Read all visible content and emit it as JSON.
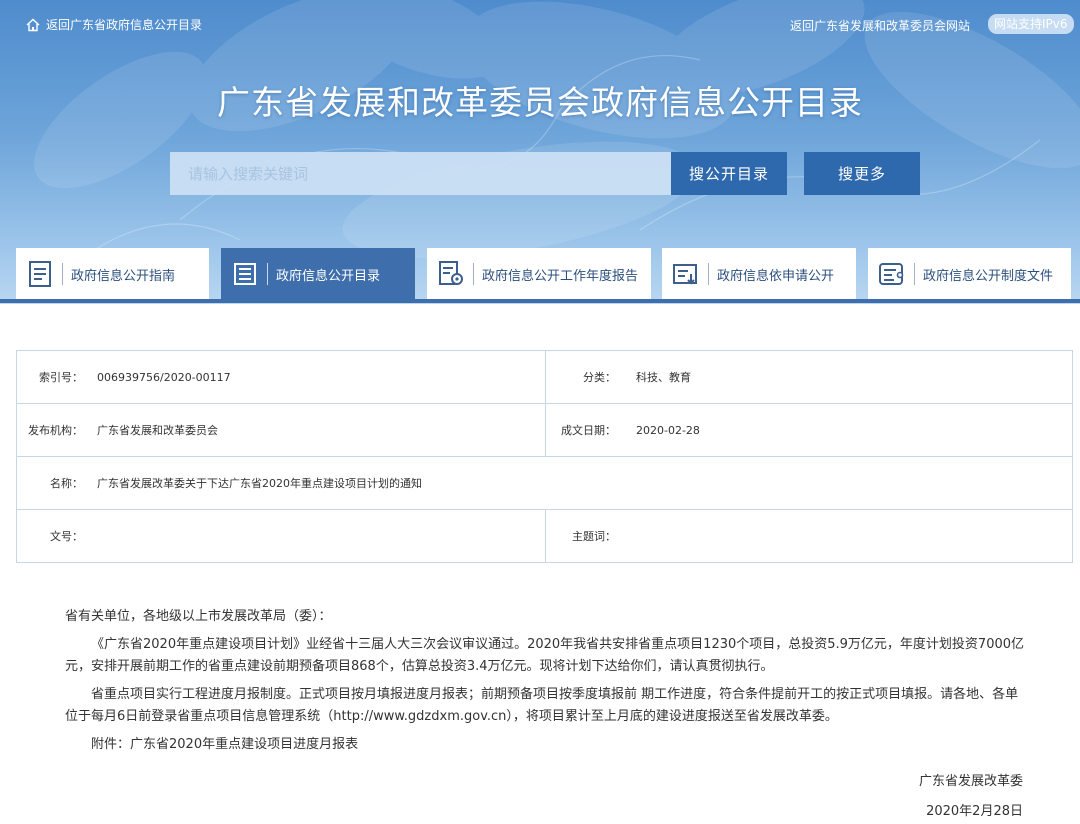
{
  "topbar": {
    "home_link": "返回广东省政府信息公开目录",
    "site_link": "返回广东省发展和改革委员会网站",
    "ipv6_badge": "网站支持IPv6"
  },
  "hero": {
    "title": "广东省发展和改革委员会政府信息公开目录",
    "search_placeholder": "请输入搜索关键词",
    "search_button": "搜公开目录",
    "more_button": "搜更多"
  },
  "nav": {
    "tabs": [
      {
        "label": "政府信息公开指南",
        "icon": "document-lines-icon",
        "active": false
      },
      {
        "label": "政府信息公开目录",
        "icon": "catalog-list-icon",
        "active": true
      },
      {
        "label": "政府信息公开工作年度报告",
        "icon": "report-gear-icon",
        "active": false
      },
      {
        "label": "政府信息依申请公开",
        "icon": "application-form-icon",
        "active": false
      },
      {
        "label": "政府信息公开制度文件",
        "icon": "policy-list-icon",
        "active": false
      }
    ]
  },
  "meta": {
    "index_label": "索引号：",
    "index_value": "006939756/2020-00117",
    "category_label": "分类：",
    "category_value": "科技、教育",
    "issuer_label": "发布机构：",
    "issuer_value": "广东省发展和改革委员会",
    "date_label": "成文日期：",
    "date_value": "2020-02-28",
    "name_label": "名称：",
    "name_value": "广东省发展改革委关于下达广东省2020年重点建设项目计划的通知",
    "docno_label": "文号：",
    "docno_value": "",
    "subject_label": "主题词：",
    "subject_value": ""
  },
  "article": {
    "salutation": "省有关单位，各地级以上市发展改革局（委）：",
    "para1": "《广东省2020年重点建设项目计划》业经省十三届人大三次会议审议通过。2020年我省共安排省重点项目1230个项目，总投资5.9万亿元，年度计划投资7000亿元，安排开展前期工作的省重点建设前期预备项目868个，估算总投资3.4万亿元。现将计划下达给你们，请认真贯彻执行。",
    "para2": "省重点项目实行工程进度月报制度。正式项目按月填报进度月报表；前期预备项目按季度填报前 期工作进度，符合条件提前开工的按正式项目填报。请各地、各单位于每月6日前登录省重点项目信息管理系统（http://www.gdzdxm.gov.cn），将项目累计至上月底的建设进度报送至省发展改革委。",
    "attachment": "附件：广东省2020年重点建设项目进度月报表",
    "signer": "广东省发展改革委",
    "sign_date": "2020年2月28日"
  },
  "colors": {
    "hero_top": "#4f8ccd",
    "hero_bottom": "#b9d7f1",
    "button": "#2f69ad",
    "nav_active": "#3e6eac",
    "nav_text": "#2b4f7e",
    "table_border": "#c7d6e6"
  }
}
